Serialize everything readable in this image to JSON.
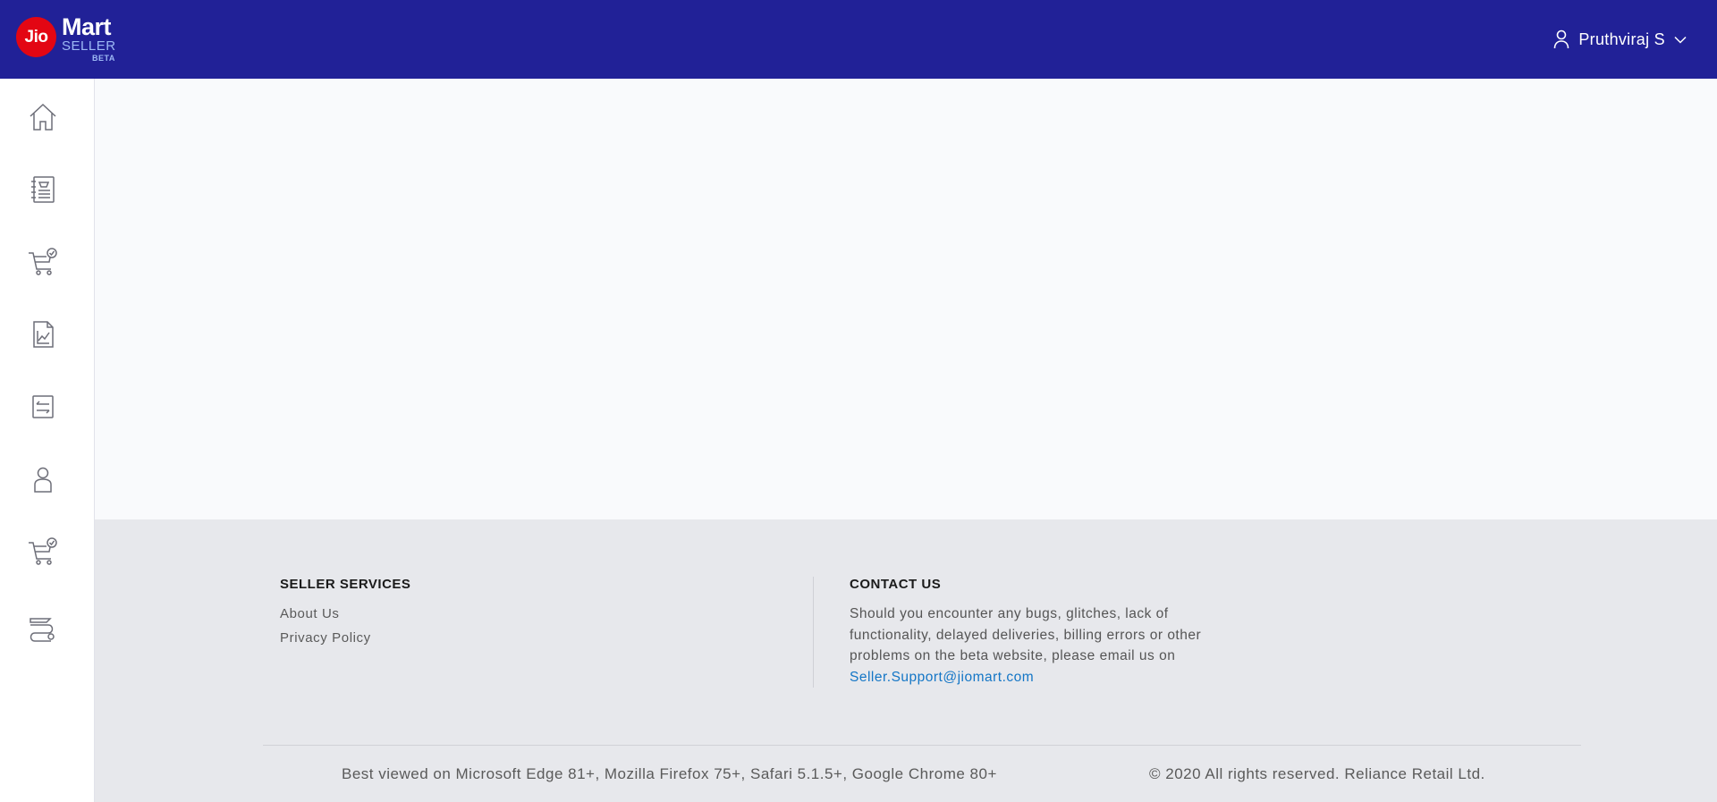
{
  "header": {
    "logo": {
      "jio": "Jio",
      "mart": "Mart",
      "seller": "SELLER",
      "beta": "BETA"
    },
    "user_name": "Pruthviraj S",
    "user_icon": "user-icon",
    "dropdown_icon": "chevron-down-icon"
  },
  "sidebar": {
    "items": [
      {
        "icon": "home-icon"
      },
      {
        "icon": "catalog-icon"
      },
      {
        "icon": "cart-check-icon"
      },
      {
        "icon": "analytics-report-icon"
      },
      {
        "icon": "transactions-icon"
      },
      {
        "icon": "profile-icon"
      },
      {
        "icon": "cart-check-icon"
      },
      {
        "icon": "shipping-icon"
      }
    ]
  },
  "footer": {
    "seller_services": {
      "title": "SELLER SERVICES",
      "links": [
        "About Us",
        "Privacy Policy"
      ]
    },
    "contact": {
      "title": "CONTACT US",
      "text": "Should you encounter any bugs, glitches, lack of functionality, delayed deliveries, billing errors or other problems on the beta website, please email us on",
      "email": "Seller.Support@jiomart.com"
    },
    "browsers": "Best viewed on Microsoft Edge 81+, Mozilla Firefox 75+, Safari 5.1.5+, Google Chrome 80+",
    "copyright": "© 2020 All rights reserved. Reliance Retail Ltd."
  },
  "colors": {
    "header_bg": "#212197",
    "logo_red": "#e30613",
    "main_bg": "#f9fafc",
    "footer_bg": "#e7e8ec",
    "link_blue": "#1476c6"
  }
}
